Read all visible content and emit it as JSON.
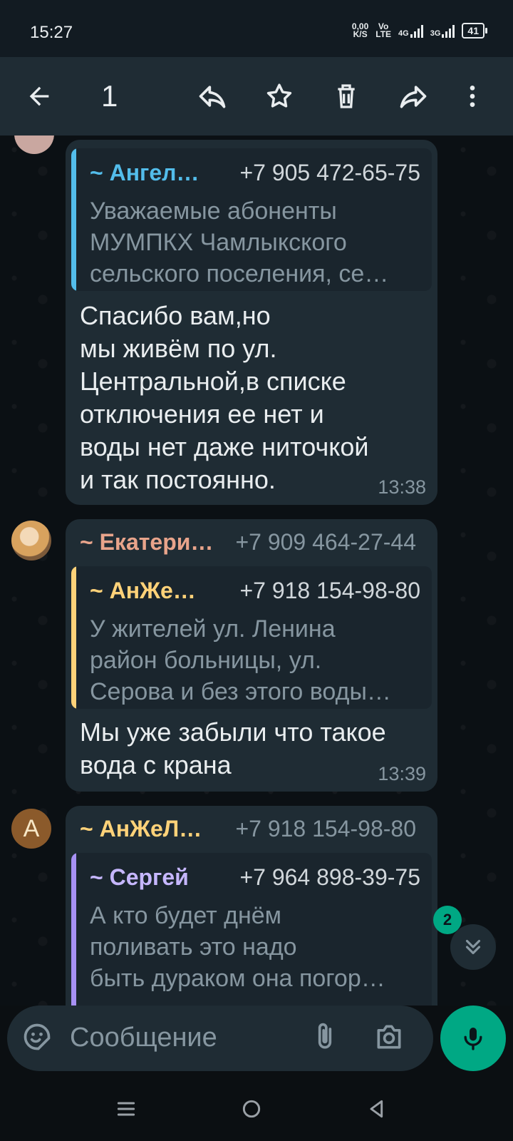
{
  "status": {
    "time": "15:27",
    "net_speed_value": "0,00",
    "net_speed_unit": "K/S",
    "volte": "Vo",
    "volte_sub": "LTE",
    "signal1_label": "4G",
    "signal2_label": "3G",
    "battery": "41"
  },
  "toolbar": {
    "selected_count": "1",
    "icons": [
      "back-arrow-icon",
      "reply-icon",
      "star-icon",
      "delete-icon",
      "forward-icon",
      "more-vert-icon"
    ]
  },
  "messages": [
    {
      "quote": {
        "name": "~ Ангел…",
        "phone": "+7 905 472-65-75",
        "lines": [
          "Уважаемые абоненты",
          "МУМПКХ Чамлыкского",
          "сельского поселения, се…"
        ],
        "bar_color": "#53bdeb",
        "name_color": "#53bdeb"
      },
      "lines": [
        "Спасибо вам,но",
        "мы живём по ул.",
        "Центральной,в списке",
        "отключения ее нет и",
        "воды нет даже ниточкой",
        "и так постоянно."
      ],
      "time": "13:38"
    },
    {
      "sender": "~ Екатери…",
      "sender_phone": "+7 909 464-27-44",
      "sender_color": "#e8a48b",
      "quote": {
        "name": "~ АнЖе…",
        "phone": "+7 918 154-98-80",
        "lines": [
          "У жителей ул. Ленина",
          "район больницы, ул.",
          "Серова и без этого воды…"
        ],
        "bar_color": "#ffd279",
        "name_color": "#ffd279"
      },
      "lines": [
        "Мы уже забыли что такое",
        "вода с крана"
      ],
      "time": "13:39"
    },
    {
      "avatar_letter": "А",
      "sender": "~ АнЖеЛ…",
      "sender_phone": "+7 918 154-98-80",
      "sender_color": "#ffd279",
      "quote": {
        "name": "~ Сергей",
        "phone": "+7 964 898-39-75",
        "lines": [
          "А кто будет днём",
          "поливать это надо",
          "быть дураком она погор…"
        ],
        "bar_color": "#a791f4",
        "name_color": "#c6b7ff"
      }
    }
  ],
  "scroll": {
    "unread_count": "2"
  },
  "composer": {
    "placeholder": "Сообщение"
  },
  "colors": {
    "accent": "#00a884",
    "bubble": "#1f2c34",
    "background": "#0b1014"
  }
}
